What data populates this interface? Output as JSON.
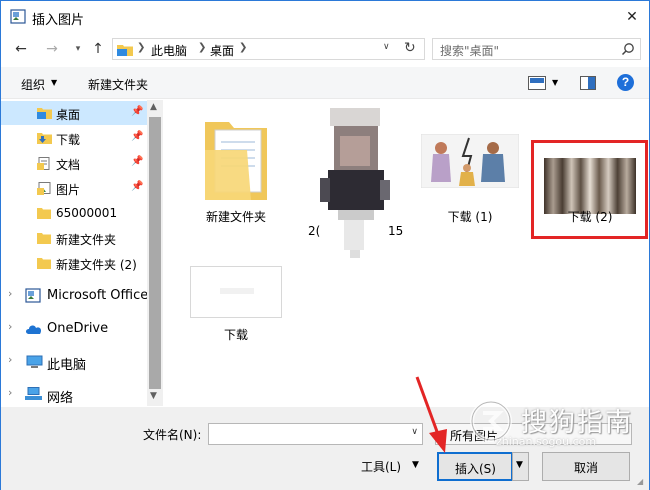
{
  "window": {
    "title": "插入图片",
    "close_glyph": "✕"
  },
  "address": {
    "crumbs": [
      "此电脑",
      "桌面"
    ],
    "search_placeholder": "搜索\"桌面\""
  },
  "toolbar": {
    "organize_label": "组织",
    "new_folder_label": "新建文件夹",
    "help_label": "?"
  },
  "sidebar": {
    "items": [
      {
        "label": "桌面",
        "icon": "desktop-folder-icon",
        "pinned": true,
        "selected": true
      },
      {
        "label": "下载",
        "icon": "download-folder-icon",
        "pinned": true
      },
      {
        "label": "文档",
        "icon": "documents-folder-icon",
        "pinned": true
      },
      {
        "label": "图片",
        "icon": "pictures-folder-icon",
        "pinned": true
      },
      {
        "label": "65000001",
        "icon": "folder-icon"
      },
      {
        "label": "新建文件夹",
        "icon": "folder-icon"
      },
      {
        "label": "新建文件夹 (2)",
        "icon": "folder-icon"
      },
      {
        "label": "Microsoft Office",
        "icon": "office-icon",
        "expandable": true
      },
      {
        "label": "OneDrive",
        "icon": "cloud-icon",
        "expandable": true
      },
      {
        "label": "此电脑",
        "icon": "computer-icon",
        "expandable": true
      },
      {
        "label": "网络",
        "icon": "network-icon",
        "expandable": true
      }
    ]
  },
  "files": [
    {
      "name": "新建文件夹",
      "type": "folder"
    },
    {
      "name": "20...15",
      "type": "image-portrait-blurred",
      "name_left": "2(",
      "name_right": "15"
    },
    {
      "name": "下载 (1)",
      "type": "image-illustration"
    },
    {
      "name": "下载 (2)",
      "type": "image-curtain",
      "highlighted": true
    },
    {
      "name": "下载",
      "type": "image-blank"
    }
  ],
  "bottom": {
    "filename_label": "文件名(N):",
    "filename_value": "",
    "filter_value": "所有图片",
    "tools_label": "工具(L)",
    "insert_label": "插入(S)",
    "cancel_label": "取消"
  },
  "watermark": {
    "text": "搜狗指南",
    "url": "zhinan.sogou.com"
  },
  "colors": {
    "highlight_border": "#e32525",
    "selection": "#cce8ff",
    "accent": "#0f6ed0"
  }
}
